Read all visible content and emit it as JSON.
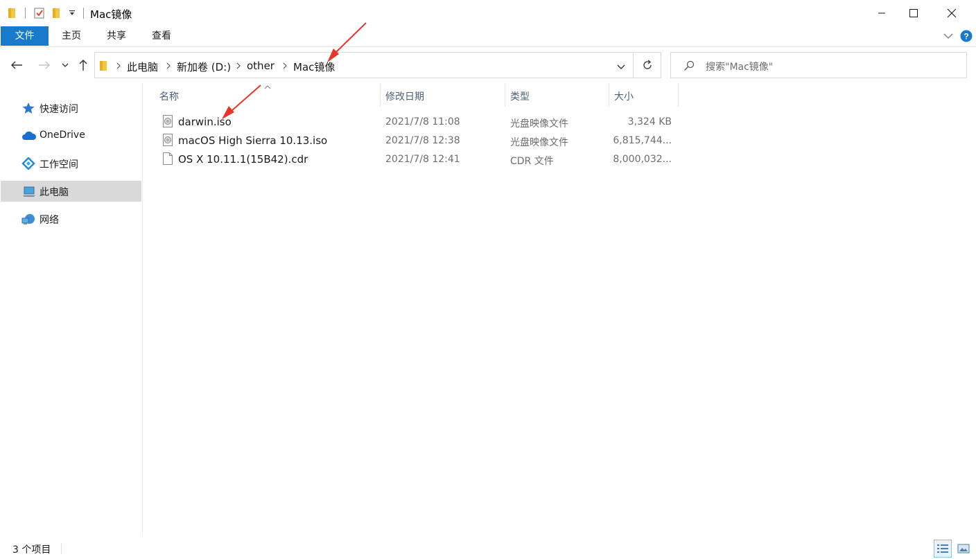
{
  "window": {
    "title": "Mac镜像"
  },
  "ribbon": {
    "tabs": [
      "文件",
      "主页",
      "共享",
      "查看"
    ]
  },
  "address": {
    "breadcrumbs": [
      "此电脑",
      "新加卷 (D:)",
      "other",
      "Mac镜像"
    ],
    "search_placeholder": "搜索\"Mac镜像\""
  },
  "nav": {
    "items": [
      {
        "label": "快速访问",
        "icon": "star-icon"
      },
      {
        "label": "OneDrive",
        "icon": "cloud-icon"
      },
      {
        "label": "工作空间",
        "icon": "workspace-icon"
      },
      {
        "label": "此电脑",
        "icon": "computer-icon",
        "selected": true
      },
      {
        "label": "网络",
        "icon": "network-icon"
      }
    ]
  },
  "columns": {
    "name": "名称",
    "date": "修改日期",
    "type": "类型",
    "size": "大小"
  },
  "files": [
    {
      "name": "darwin.iso",
      "date": "2021/7/8 11:08",
      "type": "光盘映像文件",
      "size": "3,324 KB",
      "icon": "disc-image-icon"
    },
    {
      "name": "macOS High Sierra 10.13.iso",
      "date": "2021/7/8 12:38",
      "type": "光盘映像文件",
      "size": "6,815,744...",
      "icon": "disc-image-icon"
    },
    {
      "name": "OS X 10.11.1(15B42).cdr",
      "date": "2021/7/8 12:41",
      "type": "CDR 文件",
      "size": "8,000,032...",
      "icon": "file-icon"
    }
  ],
  "status": {
    "item_count": "3 个项目"
  },
  "colors": {
    "accent": "#1979ca",
    "annotation_arrow": "#e8352b",
    "selected_nav": "#d9d9d9"
  }
}
